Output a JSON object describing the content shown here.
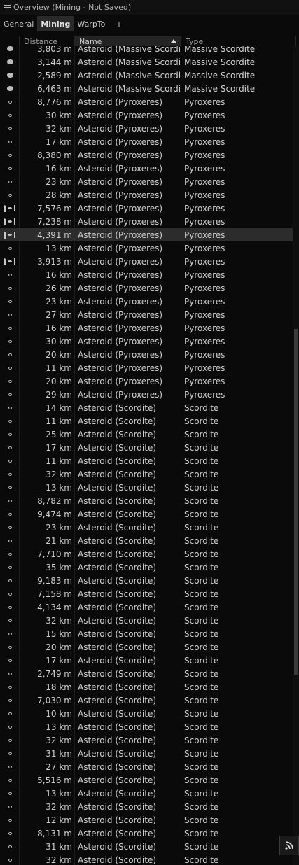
{
  "window": {
    "title": "Overview (Mining - Not Saved)"
  },
  "tabs": [
    {
      "label": "General",
      "active": false
    },
    {
      "label": "Mining",
      "active": true
    },
    {
      "label": "WarpTo",
      "active": false
    },
    {
      "label": "+",
      "active": false
    }
  ],
  "columns": {
    "distance": "Distance",
    "name": "Name",
    "type": "Type"
  },
  "rows": [
    {
      "icon": "large-asteroid-icon",
      "distance": "3,803 m",
      "name": "Asteroid (Massive Scordite)",
      "type": "Massive Scordite"
    },
    {
      "icon": "large-asteroid-icon",
      "distance": "3,144 m",
      "name": "Asteroid (Massive Scordite)",
      "type": "Massive Scordite"
    },
    {
      "icon": "large-asteroid-icon",
      "distance": "2,589 m",
      "name": "Asteroid (Massive Scordite)",
      "type": "Massive Scordite"
    },
    {
      "icon": "large-asteroid-icon",
      "distance": "6,463 m",
      "name": "Asteroid (Massive Scordite)",
      "type": "Massive Scordite"
    },
    {
      "icon": "small-asteroid-icon",
      "distance": "8,776 m",
      "name": "Asteroid (Pyroxeres)",
      "type": "Pyroxeres"
    },
    {
      "icon": "small-asteroid-icon",
      "distance": "30 km",
      "name": "Asteroid (Pyroxeres)",
      "type": "Pyroxeres"
    },
    {
      "icon": "small-asteroid-icon",
      "distance": "32 km",
      "name": "Asteroid (Pyroxeres)",
      "type": "Pyroxeres"
    },
    {
      "icon": "small-asteroid-icon",
      "distance": "17 km",
      "name": "Asteroid (Pyroxeres)",
      "type": "Pyroxeres"
    },
    {
      "icon": "small-asteroid-icon",
      "distance": "8,380 m",
      "name": "Asteroid (Pyroxeres)",
      "type": "Pyroxeres"
    },
    {
      "icon": "small-asteroid-icon",
      "distance": "16 km",
      "name": "Asteroid (Pyroxeres)",
      "type": "Pyroxeres"
    },
    {
      "icon": "small-asteroid-icon",
      "distance": "23 km",
      "name": "Asteroid (Pyroxeres)",
      "type": "Pyroxeres"
    },
    {
      "icon": "small-asteroid-icon",
      "distance": "28 km",
      "name": "Asteroid (Pyroxeres)",
      "type": "Pyroxeres"
    },
    {
      "icon": "targeted-asteroid-icon",
      "distance": "7,576 m",
      "name": "Asteroid (Pyroxeres)",
      "type": "Pyroxeres"
    },
    {
      "icon": "targeted-asteroid-icon",
      "distance": "7,238 m",
      "name": "Asteroid (Pyroxeres)",
      "type": "Pyroxeres"
    },
    {
      "icon": "targeted-asteroid-icon",
      "distance": "4,391 m",
      "name": "Asteroid (Pyroxeres)",
      "type": "Pyroxeres",
      "selected": true
    },
    {
      "icon": "small-asteroid-icon",
      "distance": "13 km",
      "name": "Asteroid (Pyroxeres)",
      "type": "Pyroxeres"
    },
    {
      "icon": "targeted-asteroid-icon",
      "distance": "3,913 m",
      "name": "Asteroid (Pyroxeres)",
      "type": "Pyroxeres"
    },
    {
      "icon": "small-asteroid-icon",
      "distance": "16 km",
      "name": "Asteroid (Pyroxeres)",
      "type": "Pyroxeres"
    },
    {
      "icon": "small-asteroid-icon",
      "distance": "26 km",
      "name": "Asteroid (Pyroxeres)",
      "type": "Pyroxeres"
    },
    {
      "icon": "small-asteroid-icon",
      "distance": "23 km",
      "name": "Asteroid (Pyroxeres)",
      "type": "Pyroxeres"
    },
    {
      "icon": "small-asteroid-icon",
      "distance": "27 km",
      "name": "Asteroid (Pyroxeres)",
      "type": "Pyroxeres"
    },
    {
      "icon": "small-asteroid-icon",
      "distance": "16 km",
      "name": "Asteroid (Pyroxeres)",
      "type": "Pyroxeres"
    },
    {
      "icon": "small-asteroid-icon",
      "distance": "30 km",
      "name": "Asteroid (Pyroxeres)",
      "type": "Pyroxeres"
    },
    {
      "icon": "small-asteroid-icon",
      "distance": "20 km",
      "name": "Asteroid (Pyroxeres)",
      "type": "Pyroxeres"
    },
    {
      "icon": "small-asteroid-icon",
      "distance": "11 km",
      "name": "Asteroid (Pyroxeres)",
      "type": "Pyroxeres"
    },
    {
      "icon": "small-asteroid-icon",
      "distance": "20 km",
      "name": "Asteroid (Pyroxeres)",
      "type": "Pyroxeres"
    },
    {
      "icon": "small-asteroid-icon",
      "distance": "29 km",
      "name": "Asteroid (Pyroxeres)",
      "type": "Pyroxeres"
    },
    {
      "icon": "small-asteroid-icon",
      "distance": "14 km",
      "name": "Asteroid (Scordite)",
      "type": "Scordite"
    },
    {
      "icon": "small-asteroid-icon",
      "distance": "11 km",
      "name": "Asteroid (Scordite)",
      "type": "Scordite"
    },
    {
      "icon": "small-asteroid-icon",
      "distance": "25 km",
      "name": "Asteroid (Scordite)",
      "type": "Scordite"
    },
    {
      "icon": "small-asteroid-icon",
      "distance": "17 km",
      "name": "Asteroid (Scordite)",
      "type": "Scordite"
    },
    {
      "icon": "small-asteroid-icon",
      "distance": "11 km",
      "name": "Asteroid (Scordite)",
      "type": "Scordite"
    },
    {
      "icon": "small-asteroid-icon",
      "distance": "32 km",
      "name": "Asteroid (Scordite)",
      "type": "Scordite"
    },
    {
      "icon": "small-asteroid-icon",
      "distance": "13 km",
      "name": "Asteroid (Scordite)",
      "type": "Scordite"
    },
    {
      "icon": "small-asteroid-icon",
      "distance": "8,782 m",
      "name": "Asteroid (Scordite)",
      "type": "Scordite"
    },
    {
      "icon": "small-asteroid-icon",
      "distance": "9,474 m",
      "name": "Asteroid (Scordite)",
      "type": "Scordite"
    },
    {
      "icon": "small-asteroid-icon",
      "distance": "23 km",
      "name": "Asteroid (Scordite)",
      "type": "Scordite"
    },
    {
      "icon": "small-asteroid-icon",
      "distance": "21 km",
      "name": "Asteroid (Scordite)",
      "type": "Scordite"
    },
    {
      "icon": "small-asteroid-icon",
      "distance": "7,710 m",
      "name": "Asteroid (Scordite)",
      "type": "Scordite"
    },
    {
      "icon": "small-asteroid-icon",
      "distance": "35 km",
      "name": "Asteroid (Scordite)",
      "type": "Scordite"
    },
    {
      "icon": "small-asteroid-icon",
      "distance": "9,183 m",
      "name": "Asteroid (Scordite)",
      "type": "Scordite"
    },
    {
      "icon": "small-asteroid-icon",
      "distance": "7,158 m",
      "name": "Asteroid (Scordite)",
      "type": "Scordite"
    },
    {
      "icon": "small-asteroid-icon",
      "distance": "4,134 m",
      "name": "Asteroid (Scordite)",
      "type": "Scordite"
    },
    {
      "icon": "small-asteroid-icon",
      "distance": "32 km",
      "name": "Asteroid (Scordite)",
      "type": "Scordite"
    },
    {
      "icon": "small-asteroid-icon",
      "distance": "15 km",
      "name": "Asteroid (Scordite)",
      "type": "Scordite"
    },
    {
      "icon": "small-asteroid-icon",
      "distance": "20 km",
      "name": "Asteroid (Scordite)",
      "type": "Scordite"
    },
    {
      "icon": "small-asteroid-icon",
      "distance": "17 km",
      "name": "Asteroid (Scordite)",
      "type": "Scordite"
    },
    {
      "icon": "small-asteroid-icon",
      "distance": "2,749 m",
      "name": "Asteroid (Scordite)",
      "type": "Scordite"
    },
    {
      "icon": "small-asteroid-icon",
      "distance": "18 km",
      "name": "Asteroid (Scordite)",
      "type": "Scordite"
    },
    {
      "icon": "small-asteroid-icon",
      "distance": "7,030 m",
      "name": "Asteroid (Scordite)",
      "type": "Scordite"
    },
    {
      "icon": "small-asteroid-icon",
      "distance": "10 km",
      "name": "Asteroid (Scordite)",
      "type": "Scordite"
    },
    {
      "icon": "small-asteroid-icon",
      "distance": "13 km",
      "name": "Asteroid (Scordite)",
      "type": "Scordite"
    },
    {
      "icon": "small-asteroid-icon",
      "distance": "32 km",
      "name": "Asteroid (Scordite)",
      "type": "Scordite"
    },
    {
      "icon": "small-asteroid-icon",
      "distance": "31 km",
      "name": "Asteroid (Scordite)",
      "type": "Scordite"
    },
    {
      "icon": "small-asteroid-icon",
      "distance": "27 km",
      "name": "Asteroid (Scordite)",
      "type": "Scordite"
    },
    {
      "icon": "small-asteroid-icon",
      "distance": "5,516 m",
      "name": "Asteroid (Scordite)",
      "type": "Scordite"
    },
    {
      "icon": "small-asteroid-icon",
      "distance": "13 km",
      "name": "Asteroid (Scordite)",
      "type": "Scordite"
    },
    {
      "icon": "small-asteroid-icon",
      "distance": "32 km",
      "name": "Asteroid (Scordite)",
      "type": "Scordite"
    },
    {
      "icon": "small-asteroid-icon",
      "distance": "12 km",
      "name": "Asteroid (Scordite)",
      "type": "Scordite"
    },
    {
      "icon": "small-asteroid-icon",
      "distance": "8,131 m",
      "name": "Asteroid (Scordite)",
      "type": "Scordite"
    },
    {
      "icon": "small-asteroid-icon",
      "distance": "31 km",
      "name": "Asteroid (Scordite)",
      "type": "Scordite"
    },
    {
      "icon": "small-asteroid-icon",
      "distance": "32 km",
      "name": "Asteroid (Scordite)",
      "type": "Scordite"
    }
  ],
  "colors": {
    "background": "#0a0a0a",
    "selected_row": "#2c2c2c",
    "text": "#cfcfcf"
  }
}
